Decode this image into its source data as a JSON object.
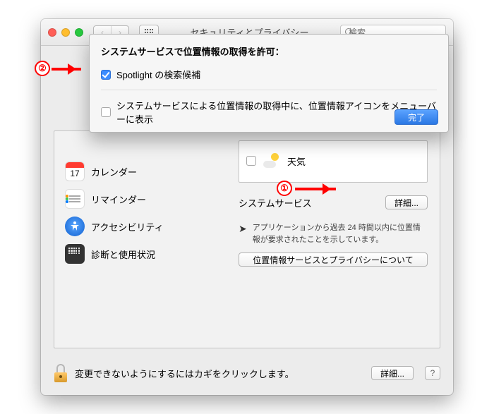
{
  "titlebar": {
    "title": "セキュリティとプライバシー",
    "search_placeholder": "検索"
  },
  "sheet": {
    "heading": "システムサービスで位置情報の取得を許可：",
    "spotlight_label": "Spotlight の検索候補",
    "menubar_label": "システムサービスによる位置情報の取得中に、位置情報アイコンをメニューバーに表示",
    "done": "完了"
  },
  "left_list": {
    "calendar": "カレンダー",
    "calendar_day": "17",
    "reminders": "リマインダー",
    "accessibility": "アクセシビリティ",
    "diagnostics": "診断と使用状況"
  },
  "right": {
    "weather": "天気",
    "system_services": "システムサービス",
    "details": "詳細...",
    "note": "アプリケーションから過去 24 時間以内に位置情報が要求されたことを示しています。",
    "privacy_btn": "位置情報サービスとプライバシーについて"
  },
  "footer": {
    "text": "変更できないようにするにはカギをクリックします。",
    "details": "詳細...",
    "help": "?"
  },
  "annotations": {
    "one": "①",
    "two": "②"
  }
}
